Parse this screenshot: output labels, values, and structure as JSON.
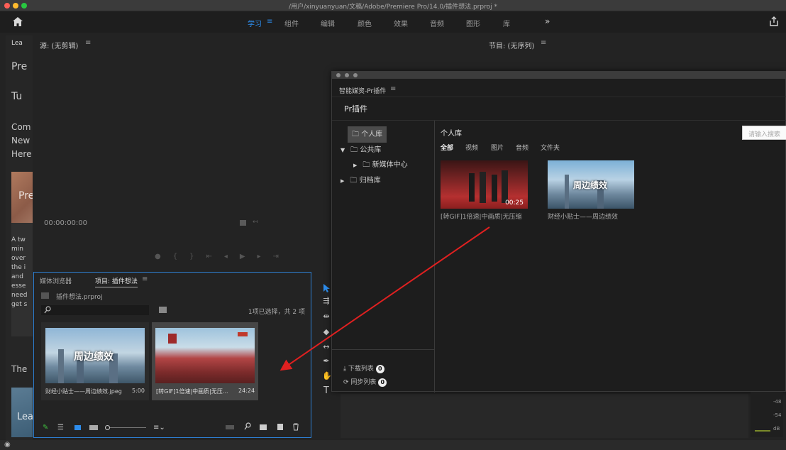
{
  "window": {
    "title": "/用户/xinyuanyuan/文稿/Adobe/Premiere Pro/14.0/插件想法.prproj *",
    "traffic_colors": [
      "#fe5f57",
      "#febc2e",
      "#28c840"
    ]
  },
  "workspaces": {
    "items": [
      "学习",
      "组件",
      "编辑",
      "颜色",
      "效果",
      "音频",
      "图形",
      "库"
    ],
    "active": "学习",
    "more": "»"
  },
  "learn_panel": {
    "tab": "Lea",
    "lines": [
      "Pre",
      "Tu",
      "Com",
      "New",
      "Here"
    ],
    "card_label": "Pre",
    "desc_lines": [
      "A tw",
      "min",
      "over",
      "the i",
      "and",
      "esse",
      "need",
      "get s"
    ],
    "bottom_title": "The",
    "bottom_card_label": "Lea"
  },
  "source_monitor": {
    "title": "源: (无剪辑)",
    "timecode": "00:00:00:00"
  },
  "program_monitor": {
    "title": "节目: (无序列)"
  },
  "project_panel": {
    "tabs": [
      "媒体浏览器",
      "项目: 插件想法"
    ],
    "active_tab": "项目: 插件想法",
    "filename": "插件想法.prproj",
    "selection_status": "1项已选择，共 2 项",
    "items": [
      {
        "name": "财经小贴士——周边绩效.jpeg",
        "duration": "5:00",
        "thumb_text": "周边绩效",
        "selected": false
      },
      {
        "name": "[转GIF]1倍速|中画质|无压...",
        "duration": "24:24",
        "thumb_text": "",
        "selected": true
      }
    ]
  },
  "plugin": {
    "panel_title": "智能媒资-Pr插件",
    "header": "Pr插件",
    "tree": [
      {
        "label": "个人库",
        "level": 0,
        "selected": true,
        "arrow": ""
      },
      {
        "label": "公共库",
        "level": 0,
        "selected": false,
        "arrow": "▼"
      },
      {
        "label": "新媒体中心",
        "level": 1,
        "selected": false,
        "arrow": "▶"
      },
      {
        "label": "归档库",
        "level": 0,
        "selected": false,
        "arrow": "▶"
      }
    ],
    "content_title": "个人库",
    "filters": [
      "全部",
      "视频",
      "图片",
      "音频",
      "文件夹"
    ],
    "active_filter": "全部",
    "search_placeholder": "请输入搜索",
    "media": [
      {
        "caption": "[转GIF]1倍速|中画质|无压缩",
        "duration": "00:25"
      },
      {
        "caption": "财经小贴士——周边绩效",
        "thumb_text": "周边绩效"
      }
    ],
    "download_list": "下载列表",
    "download_count": "0",
    "sync_list": "同步列表",
    "sync_count": "0"
  },
  "audio_meter": {
    "labels": [
      "-48",
      "-54",
      "dB"
    ]
  },
  "colors": {
    "accent": "#2d8ceb",
    "arrow": "#e02020",
    "selection_border": "#2d7fd1"
  }
}
